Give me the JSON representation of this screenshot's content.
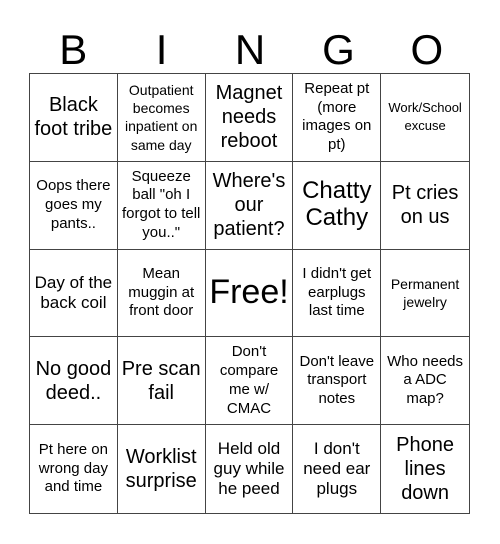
{
  "header": [
    "B",
    "I",
    "N",
    "G",
    "O"
  ],
  "cells": [
    {
      "text": "Black foot tribe",
      "size": "s-ml"
    },
    {
      "text": "Outpatient becomes inpatient on same day",
      "size": "s-xs"
    },
    {
      "text": "Magnet needs reboot",
      "size": "s-ml"
    },
    {
      "text": "Repeat pt (more images on pt)",
      "size": "s-s"
    },
    {
      "text": "Work/School excuse",
      "size": "s-xxs"
    },
    {
      "text": "Oops there goes my pants..",
      "size": "s-s"
    },
    {
      "text": "Squeeze ball \"oh I forgot to tell you..\"",
      "size": "s-s"
    },
    {
      "text": "Where's our patient?",
      "size": "s-ml"
    },
    {
      "text": "Chatty Cathy",
      "size": "s-l"
    },
    {
      "text": "Pt cries on us",
      "size": "s-ml"
    },
    {
      "text": "Day of the back coil",
      "size": "s-m"
    },
    {
      "text": "Mean muggin at front door",
      "size": "s-s"
    },
    {
      "text": "Free!",
      "size": "s-xl"
    },
    {
      "text": "I didn't get earplugs last time",
      "size": "s-s"
    },
    {
      "text": "Permanent jewelry",
      "size": "s-xs"
    },
    {
      "text": "No good deed..",
      "size": "s-ml"
    },
    {
      "text": "Pre scan fail",
      "size": "s-ml"
    },
    {
      "text": "Don't compare me w/ CMAC",
      "size": "s-s"
    },
    {
      "text": "Don't leave transport notes",
      "size": "s-s"
    },
    {
      "text": "Who needs a ADC map?",
      "size": "s-s"
    },
    {
      "text": "Pt here on wrong day and time",
      "size": "s-s"
    },
    {
      "text": "Worklist surprise",
      "size": "s-ml"
    },
    {
      "text": "Held old guy while he peed",
      "size": "s-m"
    },
    {
      "text": "I don't need ear plugs",
      "size": "s-m"
    },
    {
      "text": "Phone lines down",
      "size": "s-ml"
    }
  ]
}
